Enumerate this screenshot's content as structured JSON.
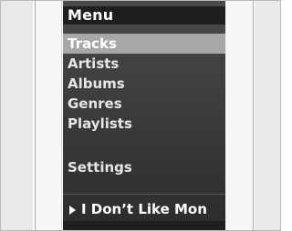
{
  "screen": {
    "title": "Menu",
    "menu_items": [
      {
        "label": "Tracks",
        "selected": true
      },
      {
        "label": "Artists",
        "selected": false
      },
      {
        "label": "Albums",
        "selected": false
      },
      {
        "label": "Genres",
        "selected": false
      },
      {
        "label": "Playlists",
        "selected": false
      }
    ],
    "settings_label": "Settings",
    "now_playing": "I Don’t Like Mon"
  },
  "colors": {
    "screen_bg": "#3a3a3a",
    "selected_bg": "#a7a7a7",
    "text": "#e6e6e6",
    "bezel": "#e9e9e9"
  },
  "icons": {
    "now_playing": "play-icon"
  }
}
